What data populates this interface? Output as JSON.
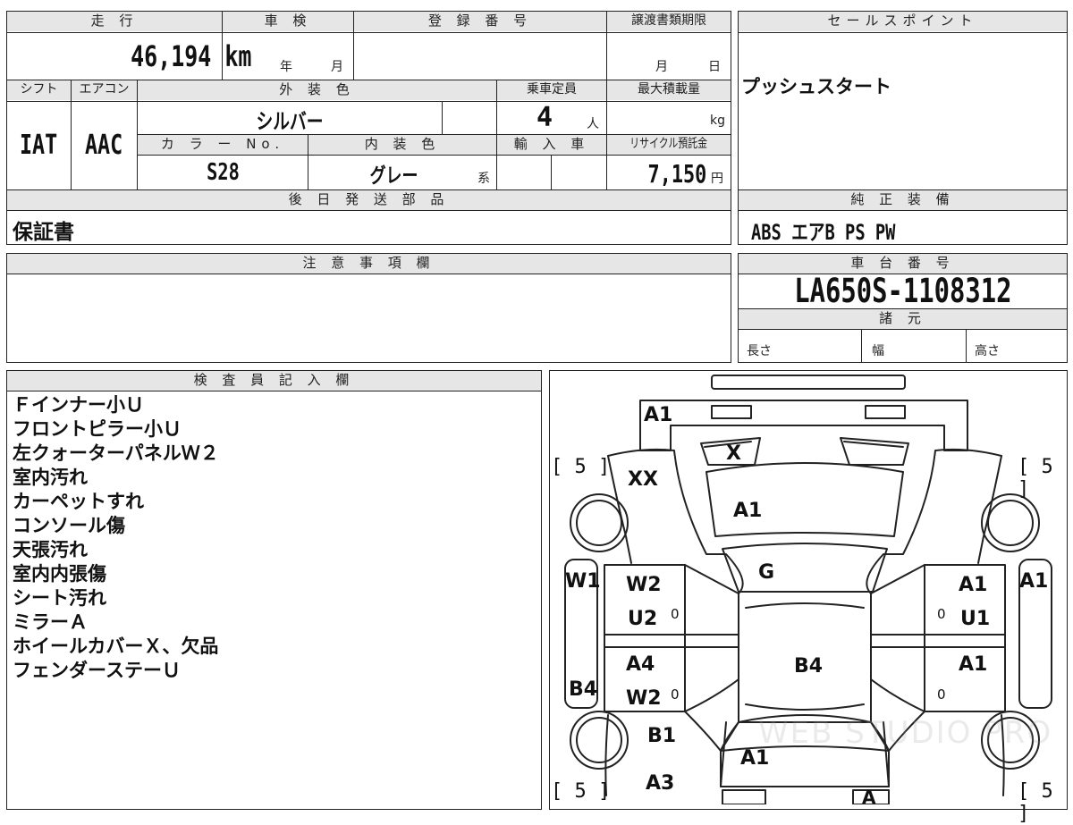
{
  "top_panel": {
    "mileage": {
      "label": "走 行",
      "value": "46,194",
      "unit": "km"
    },
    "shaken": {
      "label": "車 検",
      "year_unit": "年",
      "month_unit": "月"
    },
    "registration": {
      "label": "登 録 番 号"
    },
    "transfer_deadline": {
      "label": "譲渡書類期限",
      "month_unit": "月",
      "day_unit": "日"
    },
    "shift": {
      "label": "シフト",
      "value": "IAT"
    },
    "aircon": {
      "label": "エアコン",
      "value": "AAC"
    },
    "exterior_color": {
      "label": "外 装 色",
      "value": "シルバー"
    },
    "capacity": {
      "label": "乗車定員",
      "value": "4",
      "unit": "人"
    },
    "max_load": {
      "label": "最大積載量",
      "unit": "kg"
    },
    "color_no": {
      "label": "カ ラ ー No.",
      "value": "S28"
    },
    "interior_color": {
      "label": "内 装 色",
      "value": "グレー",
      "suffix": "系"
    },
    "import": {
      "label": "輸 入 車"
    },
    "recycle": {
      "label": "リサイクル預託金",
      "value": "7,150",
      "unit": "円"
    },
    "later_parts": {
      "label": "後 日 発 送 部 品",
      "value": "保証書"
    }
  },
  "sales_point": {
    "label": "セールスポイント",
    "value": "プッシュスタート"
  },
  "genuine_equipment": {
    "label": "純 正 装 備",
    "value": "ABS エアB PS PW"
  },
  "notes": {
    "label": "注 意 事 項 欄"
  },
  "chassis": {
    "label": "車 台 番 号",
    "value": "LA650S-1108312"
  },
  "specs": {
    "label": "諸 元",
    "length": "長さ",
    "width": "幅",
    "height": "高さ"
  },
  "inspector": {
    "label": "検 査 員 記 入 欄",
    "lines": [
      "Ｆインナー小Ｕ",
      "フロントピラー小Ｕ",
      "左クォーターパネルＷ２",
      "室内汚れ",
      "カーペットすれ",
      "コンソール傷",
      "天張汚れ",
      "室内内張傷",
      "シート汚れ",
      "ミラーＡ",
      "ホイールカバーＸ、欠品",
      "フェンダーステーＵ"
    ]
  },
  "diagram": {
    "tire_marks": {
      "front_left": "[ 5 ]",
      "front_right": "[ 5 ]",
      "rear_left": "[ 5 ]",
      "rear_right": "[ 5 ]"
    },
    "marks": {
      "bumper_front": "A1",
      "headlight": "X",
      "front_fender_left": "XX",
      "hood": "A1",
      "windshield": "G",
      "left_mirror": "W1",
      "right_mirror": "A1",
      "left_front_door_1": "W2",
      "left_front_door_2": "U2",
      "right_front_door_1": "A1",
      "right_front_door_2": "U1",
      "left_rear_door_1": "A4",
      "left_rear_door_2": "W2",
      "left_side_lower": "B4",
      "roof": "B4",
      "right_rear_door": "A1",
      "left_rear_fender_1": "B1",
      "left_rear_fender_2": "A3",
      "rear_glass": "A1",
      "rear_bumper": "A",
      "zero_mark": "0"
    },
    "watermark": "WEB STUDIO PRO"
  }
}
